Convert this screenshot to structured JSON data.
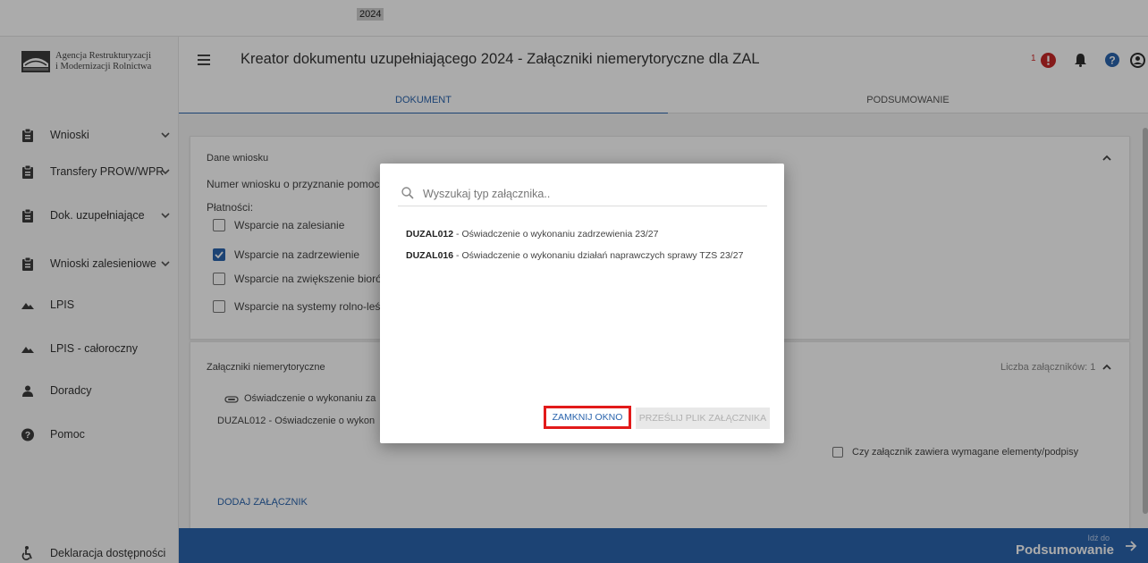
{
  "top_strip": {
    "year": "2024"
  },
  "logo": {
    "line1": "Agencja Restrukturyzacji",
    "line2": "i Modernizacji Rolnictwa",
    "icon": "arimr-logo"
  },
  "sidebar": {
    "items": [
      {
        "label": "Wnioski",
        "icon": "clipboard-icon",
        "chevron": true
      },
      {
        "label": "Transfery PROW/WPR",
        "icon": "clipboard-icon",
        "chevron": true
      },
      {
        "label": "Dok. uzupełniające",
        "icon": "clipboard-icon",
        "chevron": true
      },
      {
        "label": "Wnioski zalesieniowe",
        "icon": "clipboard-icon",
        "chevron": true
      },
      {
        "label": "LPIS",
        "icon": "mountain-icon",
        "chevron": false
      },
      {
        "label": "LPIS - całoroczny",
        "icon": "mountain-icon",
        "chevron": false
      },
      {
        "label": "Doradcy",
        "icon": "person-icon",
        "chevron": false
      },
      {
        "label": "Pomoc",
        "icon": "help-circle-icon",
        "chevron": false
      }
    ],
    "accessibility": {
      "label": "Deklaracja dostępności",
      "icon": "accessibility-icon"
    }
  },
  "header": {
    "title": "Kreator dokumentu uzupełniającego 2024 - Załączniki niemerytoryczne dla ZAL",
    "alert_count": "1"
  },
  "tabs": [
    {
      "label": "DOKUMENT",
      "active": true
    },
    {
      "label": "PODSUMOWANIE",
      "active": false
    }
  ],
  "application_card": {
    "title": "Dane wniosku",
    "application_number_label": "Numer wniosku o przyznanie pomoc",
    "payments_label": "Płatności:",
    "payments": [
      {
        "label": "Wsparcie na zalesianie",
        "checked": false
      },
      {
        "label": "Wsparcie na zadrzewienie",
        "checked": true
      },
      {
        "label": "Wsparcie na zwiększenie bioró",
        "checked": false
      },
      {
        "label": "Wsparcie na systemy rolno-leś",
        "checked": false
      }
    ]
  },
  "attachments_card": {
    "title": "Załączniki niemerytoryczne",
    "count_label": "Liczba załączników: 1",
    "file_name": "Oświadczenie o wykonaniu za",
    "type_label": "DUZAL012 - Oświadczenie o wykon",
    "checkbox_label": "Czy załącznik zawiera wymagane elementy/podpisy",
    "add_button": "DODAJ ZAŁĄCZNIK"
  },
  "bottom_bar": {
    "small": "Idź do",
    "big": "Podsumowanie"
  },
  "modal": {
    "search_placeholder": "Wyszukaj typ załącznika..",
    "options": [
      {
        "code": "DUZAL012",
        "text": " - Oświadczenie o wykonaniu zadrzewienia 23/27"
      },
      {
        "code": "DUZAL016",
        "text": " - Oświadczenie o wykonaniu działań naprawczych sprawy TZS 23/27"
      }
    ],
    "close_button": "ZAMKNIJ OKNO",
    "upload_button": "PRZEŚLIJ PLIK ZAŁĄCZNIKA"
  },
  "colors": {
    "primary": "#2a64ad",
    "highlight": "#e21a1a",
    "alert": "#d32f2f"
  }
}
